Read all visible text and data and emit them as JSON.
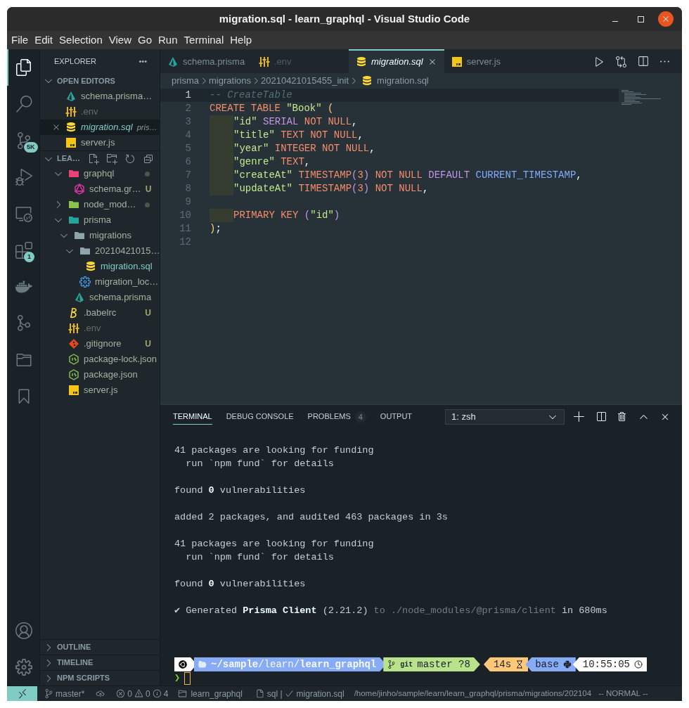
{
  "window": {
    "title": "migration.sql - learn_graphql - Visual Studio Code"
  },
  "menu": [
    "File",
    "Edit",
    "Selection",
    "View",
    "Go",
    "Run",
    "Terminal",
    "Help"
  ],
  "activity_bar": {
    "top": [
      {
        "kind": "files",
        "selected": true
      },
      {
        "kind": "search",
        "selected": false
      },
      {
        "kind": "source-control",
        "selected": false,
        "badge": "5K"
      },
      {
        "kind": "debug",
        "selected": false
      },
      {
        "kind": "remote",
        "selected": false
      },
      {
        "kind": "extensions",
        "selected": false,
        "badge": "1"
      },
      {
        "kind": "docker",
        "selected": false
      },
      {
        "kind": "git-graph",
        "selected": false
      },
      {
        "kind": "folder",
        "selected": false
      },
      {
        "kind": "bookmark",
        "selected": false
      }
    ],
    "bottom": [
      {
        "kind": "account",
        "selected": false
      },
      {
        "kind": "settings",
        "selected": false
      }
    ]
  },
  "sidebar": {
    "title": "EXPLORER",
    "more": "•••",
    "open_editors": {
      "title": "OPEN EDITORS",
      "expanded": true,
      "items": [
        {
          "name": "schema.prisma…",
          "kind": "prisma",
          "selected": false,
          "dimmed": false,
          "preview": false
        },
        {
          "name": ".env",
          "kind": "env",
          "selected": false,
          "dimmed": true,
          "preview": false
        },
        {
          "name": "migration.sql",
          "description": "pris…",
          "kind": "database",
          "selected": true,
          "dimmed": false,
          "preview": true
        },
        {
          "name": "server.js",
          "kind": "js",
          "selected": false,
          "dimmed": false,
          "preview": false
        }
      ]
    },
    "folder": {
      "title": "LEA…",
      "expanded": true,
      "tree": [
        {
          "name": "graphql",
          "kind": "folder-graphql",
          "expanded": true,
          "active": false,
          "dimmed": false,
          "dot": true,
          "children": [
            {
              "name": "schema.gr…",
              "kind": "graphql",
              "active": false,
              "dimmed": false,
              "dot": false,
              "badge": "U"
            }
          ]
        },
        {
          "name": "node_mod…",
          "kind": "folder-node",
          "expanded": false,
          "active": false,
          "dimmed": false,
          "dot": true
        },
        {
          "name": "prisma",
          "kind": "folder-prisma",
          "expanded": true,
          "active": false,
          "dimmed": false,
          "dot": false,
          "children": [
            {
              "name": "migrations",
              "kind": "folder",
              "expanded": true,
              "active": false,
              "dimmed": false,
              "dot": false,
              "children": [
                {
                  "name": "20210421015…",
                  "kind": "folder",
                  "expanded": true,
                  "active": false,
                  "dimmed": false,
                  "dot": false,
                  "children": [
                    {
                      "name": "migration.sql",
                      "kind": "database",
                      "active": true,
                      "dimmed": false,
                      "dot": false
                    }
                  ]
                },
                {
                  "name": "migration_loc…",
                  "kind": "gear",
                  "active": false,
                  "dimmed": false,
                  "dot": false
                }
              ]
            },
            {
              "name": "schema.prisma",
              "kind": "prisma",
              "active": false,
              "dimmed": false,
              "dot": false
            }
          ]
        },
        {
          "name": ".babelrc",
          "kind": "babel",
          "active": false,
          "dimmed": false,
          "dot": false,
          "badge": "U"
        },
        {
          "name": ".env",
          "kind": "env",
          "active": false,
          "dimmed": true,
          "dot": false
        },
        {
          "name": ".gitignore",
          "kind": "git",
          "active": false,
          "dimmed": false,
          "dot": false,
          "badge": "U"
        },
        {
          "name": "package-lock.json",
          "kind": "node",
          "active": false,
          "dimmed": false,
          "dot": false
        },
        {
          "name": "package.json",
          "kind": "node",
          "active": false,
          "dimmed": false,
          "dot": false
        },
        {
          "name": "server.js",
          "kind": "js",
          "active": false,
          "dimmed": false,
          "dot": false
        }
      ]
    },
    "sections": [
      {
        "title": "OUTLINE",
        "expanded": false
      },
      {
        "title": "TIMELINE",
        "expanded": false
      },
      {
        "title": "NPM SCRIPTS",
        "expanded": false
      }
    ]
  },
  "tabs": [
    {
      "label": "schema.prisma",
      "kind": "prisma",
      "selected": false,
      "dimmed": false,
      "preview": false
    },
    {
      "label": ".env",
      "kind": "env",
      "selected": false,
      "dimmed": true,
      "preview": false
    },
    {
      "label": "migration.sql",
      "kind": "database",
      "selected": true,
      "dimmed": false,
      "preview": true
    },
    {
      "label": "server.js",
      "kind": "js",
      "selected": false,
      "dimmed": false,
      "preview": false
    }
  ],
  "breadcrumb": [
    "prisma",
    "migrations",
    "20210421015455_init",
    "migration.sql"
  ],
  "editor": {
    "lines": [
      {
        "number": "1",
        "current": true,
        "indented": false,
        "tokens": [
          {
            "kind": "comment",
            "text": "-- CreateTable"
          }
        ]
      },
      {
        "number": "2",
        "current": false,
        "indented": false,
        "tokens": [
          {
            "kind": "keyword",
            "text": "CREATE TABLE "
          },
          {
            "kind": "string",
            "text": "\"Book\" "
          },
          {
            "kind": "bracket",
            "text": "("
          }
        ]
      },
      {
        "number": "3",
        "current": false,
        "indented": true,
        "tokens": [
          {
            "kind": "string",
            "text": "\"id\""
          },
          {
            "kind": "type",
            "text": " SERIAL"
          },
          {
            "kind": "keyword",
            "text": " NOT NULL"
          },
          {
            "kind": "plain",
            "text": ","
          }
        ]
      },
      {
        "number": "4",
        "current": false,
        "indented": true,
        "tokens": [
          {
            "kind": "string",
            "text": "\"title\""
          },
          {
            "kind": "keyword",
            "text": " TEXT NOT NULL"
          },
          {
            "kind": "plain",
            "text": ","
          }
        ]
      },
      {
        "number": "5",
        "current": false,
        "indented": true,
        "tokens": [
          {
            "kind": "string",
            "text": "\"year\""
          },
          {
            "kind": "keyword",
            "text": " INTEGER NOT NULL"
          },
          {
            "kind": "plain",
            "text": ","
          }
        ]
      },
      {
        "number": "6",
        "current": false,
        "indented": true,
        "tokens": [
          {
            "kind": "string",
            "text": "\"genre\""
          },
          {
            "kind": "keyword",
            "text": " TEXT"
          },
          {
            "kind": "plain",
            "text": ","
          }
        ]
      },
      {
        "number": "7",
        "current": false,
        "indented": true,
        "tokens": [
          {
            "kind": "string",
            "text": "\"createAt\""
          },
          {
            "kind": "keyword",
            "text": " TIMESTAMP"
          },
          {
            "kind": "type",
            "text": "("
          },
          {
            "kind": "keyword",
            "text": "3"
          },
          {
            "kind": "type",
            "text": ")"
          },
          {
            "kind": "keyword",
            "text": " NOT NULL "
          },
          {
            "kind": "type",
            "text": "DEFAULT"
          },
          {
            "kind": "function",
            "text": " CURRENT_TIMESTAMP"
          },
          {
            "kind": "plain",
            "text": ","
          }
        ]
      },
      {
        "number": "8",
        "current": false,
        "indented": true,
        "tokens": [
          {
            "kind": "string",
            "text": "\"updateAt\""
          },
          {
            "kind": "keyword",
            "text": " TIMESTAMP"
          },
          {
            "kind": "type",
            "text": "("
          },
          {
            "kind": "keyword",
            "text": "3"
          },
          {
            "kind": "type",
            "text": ")"
          },
          {
            "kind": "keyword",
            "text": " NOT NULL"
          },
          {
            "kind": "plain",
            "text": ","
          }
        ]
      },
      {
        "number": "9",
        "current": false,
        "indented": false
      },
      {
        "number": "10",
        "current": false,
        "indented": true,
        "tokens": [
          {
            "kind": "keyword",
            "text": "PRIMARY KEY "
          },
          {
            "kind": "type",
            "text": "("
          },
          {
            "kind": "string",
            "text": "\"id\""
          },
          {
            "kind": "type",
            "text": ")"
          }
        ]
      },
      {
        "number": "11",
        "current": false,
        "indented": false,
        "tokens": [
          {
            "kind": "bracket",
            "text": ")"
          },
          {
            "kind": "plain",
            "text": ";"
          }
        ]
      },
      {
        "number": "12",
        "current": false,
        "indented": false
      }
    ]
  },
  "panel": {
    "tabs": [
      {
        "label": "TERMINAL",
        "selected": true
      },
      {
        "label": "DEBUG CONSOLE",
        "selected": false
      },
      {
        "label": "PROBLEMS",
        "selected": false,
        "badge": "4"
      },
      {
        "label": "OUTPUT",
        "selected": false
      }
    ],
    "terminal_select": "1: zsh",
    "blocks": [
      [
        [
          {
            "kind": "plain",
            "text": "41 packages are looking for funding"
          }
        ],
        [
          {
            "kind": "plain",
            "text": "  run `npm fund` for details"
          }
        ]
      ],
      [
        [
          {
            "kind": "plain",
            "text": "found "
          },
          {
            "kind": "bold",
            "text": "0"
          },
          {
            "kind": "plain",
            "text": " vulnerabilities"
          }
        ]
      ],
      [
        [
          {
            "kind": "plain",
            "text": "added 2 packages, and audited 463 packages in 3s"
          }
        ]
      ],
      [
        [
          {
            "kind": "plain",
            "text": "41 packages are looking for funding"
          }
        ],
        [
          {
            "kind": "plain",
            "text": "  run `npm fund` for details"
          }
        ]
      ],
      [
        [
          {
            "kind": "plain",
            "text": "found "
          },
          {
            "kind": "bold",
            "text": "0"
          },
          {
            "kind": "plain",
            "text": " vulnerabilities"
          }
        ]
      ],
      [
        [
          {
            "kind": "plain",
            "text": "✔ Generated "
          },
          {
            "kind": "bold",
            "text": "Prisma Client"
          },
          {
            "kind": "plain",
            "text": " (2.21.2) "
          },
          {
            "kind": "dim",
            "text": "to ./node_modules/@prisma/client"
          },
          {
            "kind": "plain",
            "text": " in 680ms"
          }
        ]
      ]
    ],
    "prompt": {
      "left": [
        {
          "kind": "os",
          "color": "#ffffff"
        },
        {
          "kind": "dir",
          "text": "**~/sample**/learn/**learn_graphql**",
          "color": "#87acf5"
        },
        {
          "kind": "git",
          "label": "git",
          "text": "master ?8",
          "color": "#b9e28c"
        }
      ],
      "right": [
        {
          "kind": "duration",
          "text": "14s",
          "color": "#fdc877"
        },
        {
          "kind": "env",
          "text": "base",
          "color": "#87acf5"
        },
        {
          "kind": "time",
          "text": "10:55:05",
          "color": "#ffffff"
        }
      ],
      "symbol": "❯"
    }
  },
  "status_bar": {
    "branch": "master*",
    "errors": "0",
    "warnings": "0",
    "infos": "4",
    "folder": "learn_graphql",
    "language": "sql |",
    "file": "migration.sql",
    "path": "/home/jinho/sample/learn/learn_graphql/prisma/migrations/202104",
    "mode": "-- NORMAL --"
  }
}
